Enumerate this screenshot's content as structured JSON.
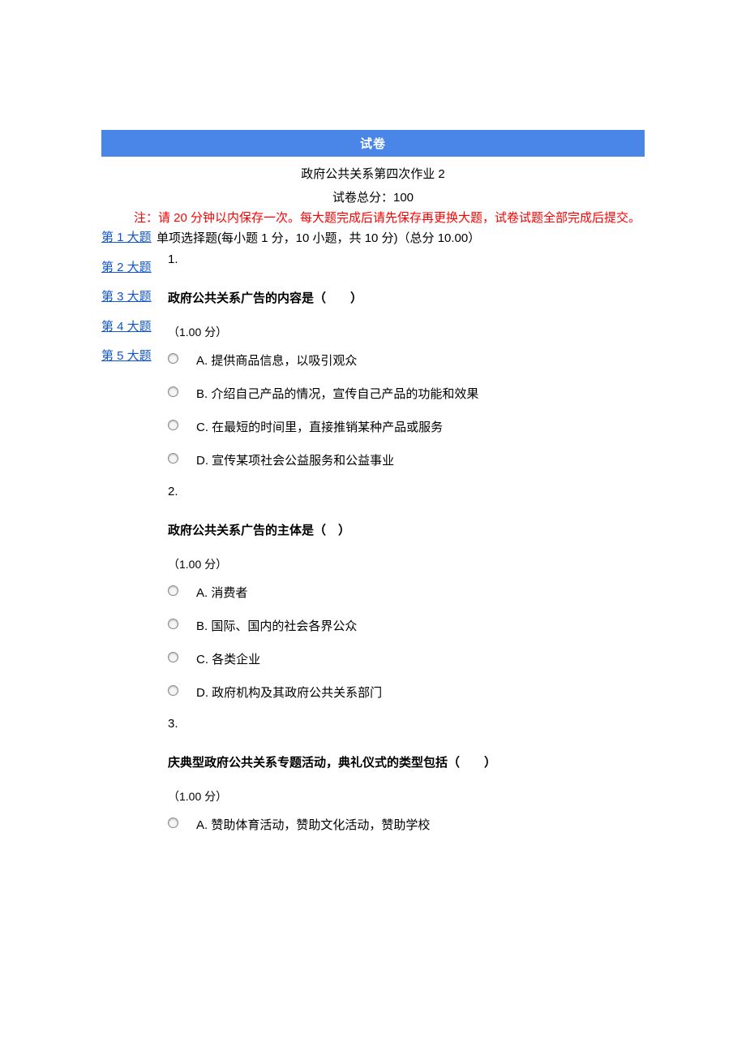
{
  "header": {
    "bar": "试卷",
    "title": "政府公共关系第四次作业 2",
    "total": "试卷总分：100",
    "notice": "注：请 20 分钟以内保存一次。每大题完成后请先保存再更换大题，试卷试题全部完成后提交。"
  },
  "nav": [
    {
      "label": "第 1 大题"
    },
    {
      "label": "第 2 大题"
    },
    {
      "label": "第 3 大题"
    },
    {
      "label": "第 4 大题"
    },
    {
      "label": "第 5 大题"
    }
  ],
  "section": {
    "heading": "单项选择题(每小题 1 分，10 小题，共 10 分)（总分 10.00）"
  },
  "questions": [
    {
      "num": "1.",
      "stem": "政府公共关系广告的内容是（　　）",
      "points": "（1.00 分）",
      "options": [
        "A.  提供商品信息，以吸引观众",
        "B.  介绍自己产品的情况，宣传自己产品的功能和效果",
        "C.  在最短的时间里，直接推销某种产品或服务",
        "D.  宣传某项社会公益服务和公益事业"
      ]
    },
    {
      "num": "2.",
      "stem": "政府公共关系广告的主体是（　）",
      "points": "（1.00 分）",
      "options": [
        "A.  消费者",
        "B.  国际、国内的社会各界公众",
        "C.  各类企业",
        "D.  政府机构及其政府公共关系部门"
      ]
    },
    {
      "num": "3.",
      "stem": "庆典型政府公共关系专题活动，典礼仪式的类型包括（　　）",
      "points": "（1.00 分）",
      "options": [
        "A.  赞助体育活动，赞助文化活动，赞助学校"
      ]
    }
  ]
}
